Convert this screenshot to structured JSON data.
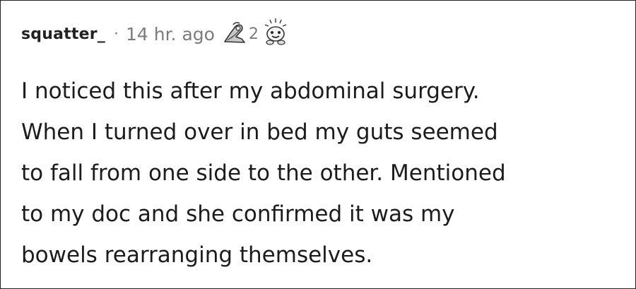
{
  "comment": {
    "username": "squatter_",
    "separator": "·",
    "timestamp": "14 hr. ago",
    "awards": {
      "count": "2",
      "icons": [
        "arm-wrestle-award-icon",
        "wholesome-seal-award-icon"
      ]
    },
    "body_lines": [
      "I noticed this after my abdominal surgery.",
      "When I turned over in bed my guts seemed",
      "to fall from one side to the other. Mentioned",
      "to my doc and she confirmed it was my",
      "bowels rearranging themselves."
    ]
  },
  "colors": {
    "text": "#1c1c1c",
    "meta": "#7c7c7c",
    "background": "#ffffff"
  }
}
